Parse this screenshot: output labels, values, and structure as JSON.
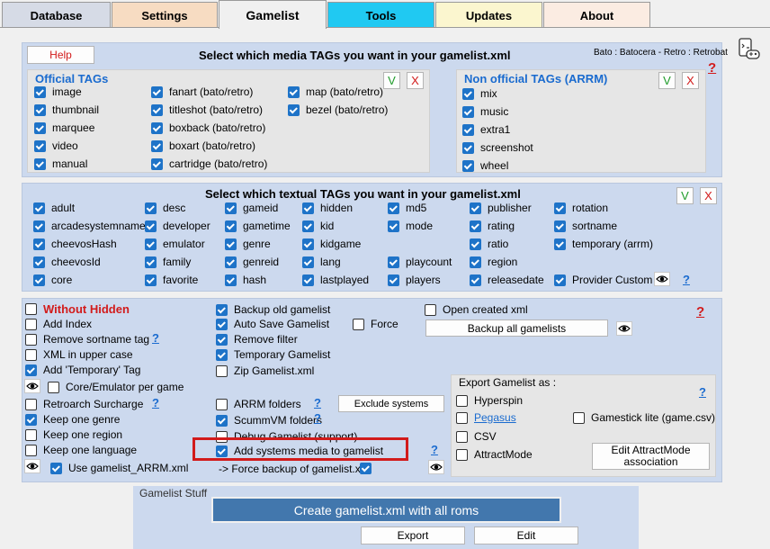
{
  "tabs": [
    {
      "label": "Database",
      "color": "#d6dbe6"
    },
    {
      "label": "Settings",
      "color": "#f7dcc2"
    },
    {
      "label": "Gamelist",
      "color": "#f0f0f0"
    },
    {
      "label": "Tools",
      "color": "#20c9f2"
    },
    {
      "label": "Updates",
      "color": "#fbf6cf"
    },
    {
      "label": "About",
      "color": "#fbece2"
    }
  ],
  "media": {
    "help_label": "Help",
    "title": "Select which media TAGs you want in your gamelist.xml",
    "systems_note": "Bato : Batocera - Retro : Retrobat",
    "official": {
      "title": "Official TAGs",
      "items": [
        "image",
        "thumbnail",
        "marquee",
        "video",
        "manual",
        "fanart (bato/retro)",
        "titleshot (bato/retro)",
        "boxback (bato/retro)",
        "boxart (bato/retro)",
        "cartridge (bato/retro)",
        "map (bato/retro)",
        "bezel (bato/retro)"
      ]
    },
    "nonofficial": {
      "title": "Non official TAGs  (ARRM)",
      "items": [
        "mix",
        "music",
        "extra1",
        "screenshot",
        "wheel"
      ]
    },
    "v_label": "V",
    "x_label": "X",
    "help_q": "?"
  },
  "textual": {
    "title": "Select which textual TAGs you want in your gamelist.xml",
    "items": [
      "adult",
      "arcadesystemname",
      "cheevosHash",
      "cheevosId",
      "core",
      "desc",
      "developer",
      "emulator",
      "family",
      "favorite",
      "gameid",
      "gametime",
      "genre",
      "genreid",
      "hash",
      "hidden",
      "kid",
      "kidgame",
      "lang",
      "lastplayed",
      "md5",
      "mode",
      "playcount",
      "players",
      "publisher",
      "rating",
      "ratio",
      "region",
      "releasedate",
      "rotation",
      "sortname",
      "temporary (arrm)",
      "Provider Custom"
    ],
    "q": "?"
  },
  "options": {
    "col1": [
      {
        "label": "Without Hidden",
        "checked": false
      },
      {
        "label": "Add Index",
        "checked": false
      },
      {
        "label": "Remove sortname tag",
        "checked": false
      },
      {
        "label": "XML in upper case",
        "checked": false
      },
      {
        "label": "Add 'Temporary' Tag",
        "checked": true
      },
      {
        "label": "Core/Emulator per game",
        "checked": false
      },
      {
        "label": "Retroarch Surcharge",
        "checked": false
      },
      {
        "label": "Keep one genre",
        "checked": true
      },
      {
        "label": "Keep one region",
        "checked": false
      },
      {
        "label": "Keep one language",
        "checked": false
      },
      {
        "label": "Use gamelist_ARRM.xml",
        "checked": true
      }
    ],
    "col2": [
      {
        "label": "Backup old gamelist",
        "checked": true
      },
      {
        "label": "Auto Save Gamelist",
        "checked": true
      },
      {
        "label": "Remove filter",
        "checked": true
      },
      {
        "label": "Temporary Gamelist",
        "checked": true
      },
      {
        "label": "Zip Gamelist.xml",
        "checked": false
      },
      {
        "label": "ARRM folders",
        "checked": false
      },
      {
        "label": "ScummVM folders",
        "checked": true
      },
      {
        "label": "Debug Gamelist (support)",
        "checked": false
      },
      {
        "label": "Add systems media to gamelist",
        "checked": true
      }
    ],
    "force_label": "Force",
    "force_backup_label": "-> Force backup of gamelist.xml",
    "open_created_label": "Open created xml",
    "backup_all_label": "Backup all gamelists",
    "exclude_label": "Exclude systems",
    "q": "?"
  },
  "export": {
    "title": "Export Gamelist as :",
    "items": [
      {
        "label": "Hyperspin",
        "checked": false
      },
      {
        "label": "Pegasus",
        "checked": false
      },
      {
        "label": "CSV",
        "checked": false
      },
      {
        "label": "AttractMode",
        "checked": false
      },
      {
        "label": "Gamestick lite (game.csv)",
        "checked": false
      }
    ],
    "attract_btn": "Edit AttractMode association",
    "q": "?"
  },
  "stuff": {
    "title": "Gamelist Stuff",
    "create_label": "Create gamelist.xml with all roms",
    "export_label": "Export",
    "edit_label": "Edit"
  },
  "colors": {
    "accent": "#1e73c8",
    "highlight": "#d21b1b"
  }
}
